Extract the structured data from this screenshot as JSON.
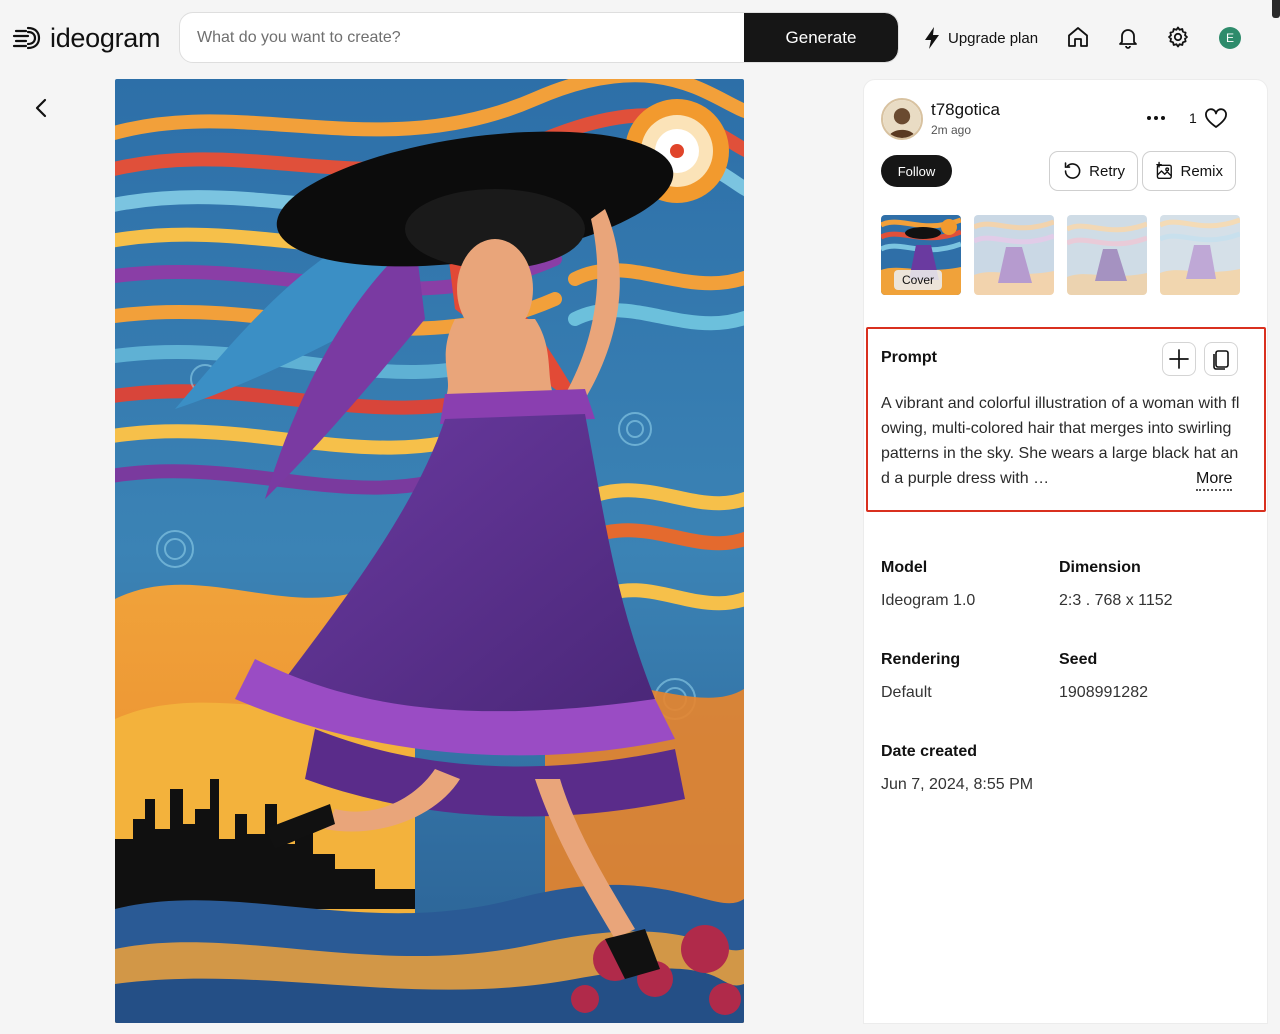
{
  "header": {
    "logo_text": "ideogram",
    "search": {
      "placeholder": "What do you want to create?",
      "value": ""
    },
    "generate_label": "Generate",
    "upgrade_label": "Upgrade plan",
    "avatar_initial": "E",
    "icons": [
      "home-icon",
      "bell-icon",
      "gear-icon"
    ]
  },
  "post": {
    "username": "t78gotica",
    "time_ago": "2m ago",
    "like_count": "1",
    "follow_label": "Follow",
    "retry_label": "Retry",
    "remix_label": "Remix",
    "thumbnails": [
      {
        "badge": "Cover"
      },
      {
        "badge": ""
      },
      {
        "badge": ""
      },
      {
        "badge": ""
      }
    ]
  },
  "prompt": {
    "title": "Prompt",
    "text": "A vibrant and colorful illustration of a woman with flowing, multi-colored hair that merges into swirling patterns in the sky. She wears a large black hat and a purple dress with …",
    "more_label": "More"
  },
  "details": {
    "model_label": "Model",
    "model_value": "Ideogram 1.0",
    "dimension_label": "Dimension",
    "dimension_value": "2:3 . 768 x 1152",
    "rendering_label": "Rendering",
    "rendering_value": "Default",
    "seed_label": "Seed",
    "seed_value": "1908991282",
    "date_label": "Date created",
    "date_value": "Jun 7, 2024, 8:55 PM"
  },
  "colors": {
    "accent_dark": "#161616",
    "highlight_border": "#d9301f",
    "avatar_bg": "#2e8b6b"
  }
}
